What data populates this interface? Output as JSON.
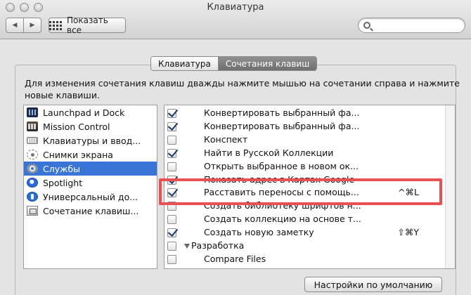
{
  "window": {
    "title": "Клавиатура"
  },
  "toolbar": {
    "show_all_label": "Показать все",
    "back_glyph": "◀",
    "forward_glyph": "▶",
    "search_value": ""
  },
  "tabs": [
    {
      "label": "Клавиатура",
      "active": false
    },
    {
      "label": "Сочетания клавиш",
      "active": true
    }
  ],
  "instruction_text": "Для изменения сочетания клавиш дважды нажмите мышью на сочетании справа и нажмите новые клавиши.",
  "categories": [
    {
      "label": "Launchpad и Dock",
      "icon": "launchpad-icon",
      "selected": false
    },
    {
      "label": "Mission Control",
      "icon": "mission-control-icon",
      "selected": false
    },
    {
      "label": "Клавиатуры и ввод...",
      "icon": "keyboard-icon",
      "selected": false
    },
    {
      "label": "Снимки экрана",
      "icon": "screenshot-icon",
      "selected": false
    },
    {
      "label": "Службы",
      "icon": "gear-icon",
      "selected": true
    },
    {
      "label": "Spotlight",
      "icon": "spotlight-icon",
      "selected": false
    },
    {
      "label": "Универсальный до...",
      "icon": "accessibility-icon",
      "selected": false
    },
    {
      "label": "Сочетание клавиш...",
      "icon": "app-shortcuts-icon",
      "selected": false
    }
  ],
  "shortcuts": [
    {
      "label": "Конвертировать выбранный фа...",
      "checked": true,
      "key": ""
    },
    {
      "label": "Конвертировать выбранный фа...",
      "checked": true,
      "key": ""
    },
    {
      "label": "Конспект",
      "checked": false,
      "key": ""
    },
    {
      "label": "Найти в Русской Коллекции",
      "checked": true,
      "key": ""
    },
    {
      "label": "Открыть выбранное в новом ок...",
      "checked": false,
      "key": ""
    },
    {
      "label": "Показать адрес в Картах Google",
      "checked": true,
      "key": ""
    },
    {
      "label": "Расставить переносы с помощь...",
      "checked": true,
      "key": "^⌘L"
    },
    {
      "label": "Создать библиотеку шрифтов н...",
      "checked": false,
      "key": ""
    },
    {
      "label": "Создать коллекцию на основе т...",
      "checked": false,
      "key": ""
    },
    {
      "label": "Создать новую заметку",
      "checked": true,
      "key": "⇧⌘Y"
    },
    {
      "label": "Разработка",
      "checked": false,
      "key": "",
      "group": true
    },
    {
      "label": "Compare Files",
      "checked": false,
      "key": ""
    }
  ],
  "reset_button_label": "Настройки по умолчанию",
  "colors": {
    "selection": "#3875d7",
    "highlight": "#e85151"
  }
}
